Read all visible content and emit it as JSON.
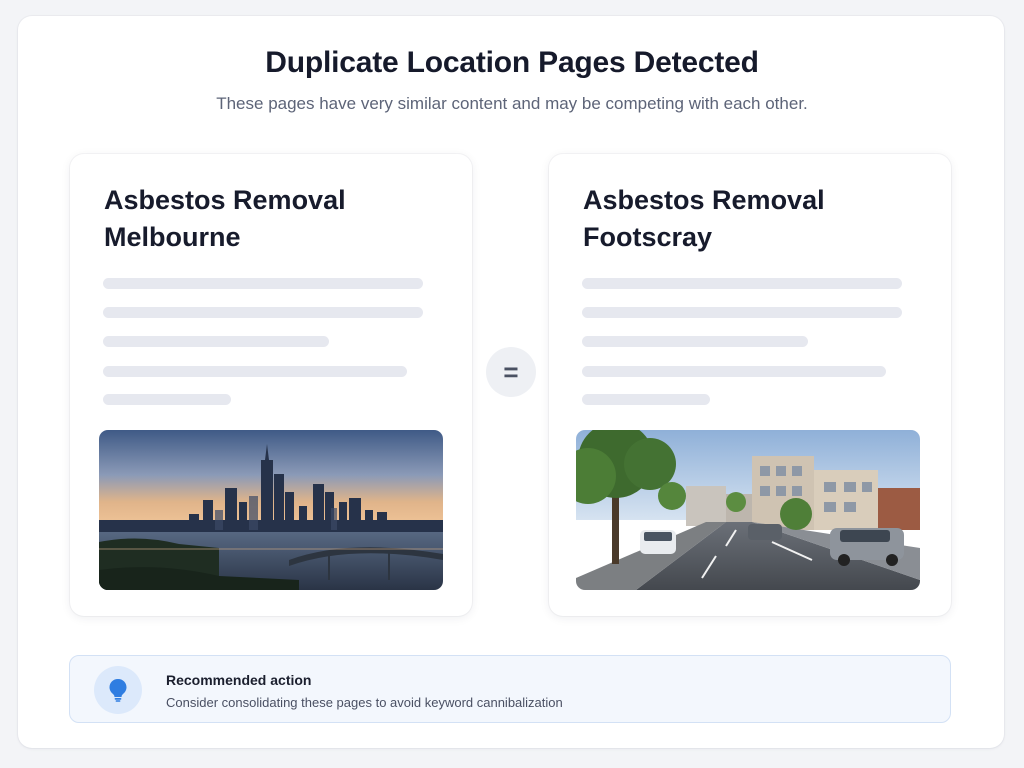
{
  "header": {
    "title": "Duplicate Location Pages Detected",
    "subtitle": "These pages have very similar content and may be competing with each other."
  },
  "comparison": {
    "operator_symbol": "="
  },
  "pages": [
    {
      "title_line1": "Asbestos Removal",
      "title_line2": "Melbourne",
      "image": "city-skyline-image"
    },
    {
      "title_line1": "Asbestos Removal",
      "title_line2": "Footscray",
      "image": "suburban-street-image"
    }
  ],
  "recommendation": {
    "icon": "lightbulb-icon",
    "title": "Recommended action",
    "text": "Consider consolidating these pages to avoid keyword cannibalization"
  },
  "colors": {
    "accent": "#2f7de1",
    "accent_soft": "#dce9fb",
    "placeholder_bar": "#e6e8ef"
  }
}
